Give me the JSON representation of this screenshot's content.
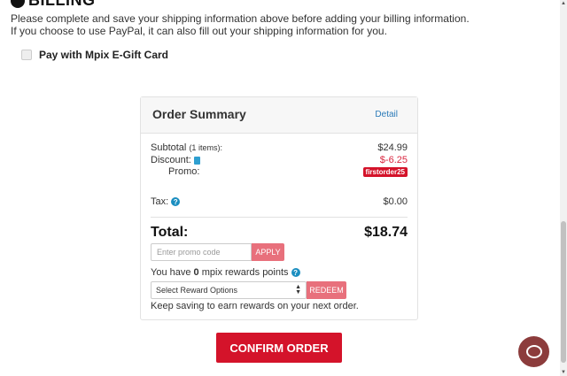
{
  "section": {
    "title": "BILLING"
  },
  "notice": {
    "line1": "Please complete and save your shipping information above before adding your billing information.",
    "line2": "If you choose to use PayPal, it can also fill out your shipping information for you."
  },
  "gift_card": {
    "label": "Pay with Mpix E-Gift Card",
    "checked": false
  },
  "summary": {
    "title": "Order Summary",
    "detail_link": "Detail",
    "subtotal_label": "Subtotal",
    "subtotal_items": "(1 items):",
    "subtotal_value": "$24.99",
    "discount_label": "Discount:",
    "discount_value": "$-6.25",
    "promo_label": "Promo:",
    "promo_code": "firstorder25",
    "tax_label": "Tax:",
    "tax_value": "$0.00",
    "total_label": "Total:",
    "total_value": "$18.74",
    "promo_input_placeholder": "Enter promo code",
    "apply_label": "APPLY",
    "rewards_prefix": "You have",
    "rewards_points": "0",
    "rewards_suffix": "mpix rewards points",
    "reward_select_value": "Select Reward Options",
    "redeem_label": "REDEEM",
    "keep_saving": "Keep saving to earn rewards on your next order."
  },
  "confirm": {
    "label": "CONFIRM ORDER"
  },
  "colors": {
    "accent": "#d4132a",
    "button_light": "#e8707c",
    "link": "#2a7ab8",
    "chat": "#8c3c3c"
  },
  "icons": {
    "trash": "trash-icon",
    "help": "help-icon",
    "chat": "chat-icon"
  }
}
